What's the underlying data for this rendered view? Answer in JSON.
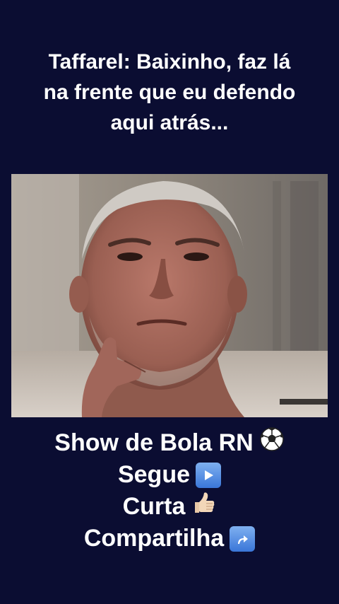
{
  "caption_top": {
    "lines": [
      "Taffarel: Baixinho, faz lá",
      "na frente que eu defendo",
      "aqui atrás..."
    ]
  },
  "caption_bottom": {
    "line1": "Show de Bola RN",
    "line2": "Segue",
    "line3": "Curta",
    "line4": "Compartilha"
  },
  "icons": {
    "line1": "soccer-ball-icon",
    "line2": "play-button-icon",
    "line3": "thumbs-up-icon",
    "line4": "share-arrow-icon"
  },
  "colors": {
    "background": "#0b0d32",
    "text": "#ffffff"
  }
}
